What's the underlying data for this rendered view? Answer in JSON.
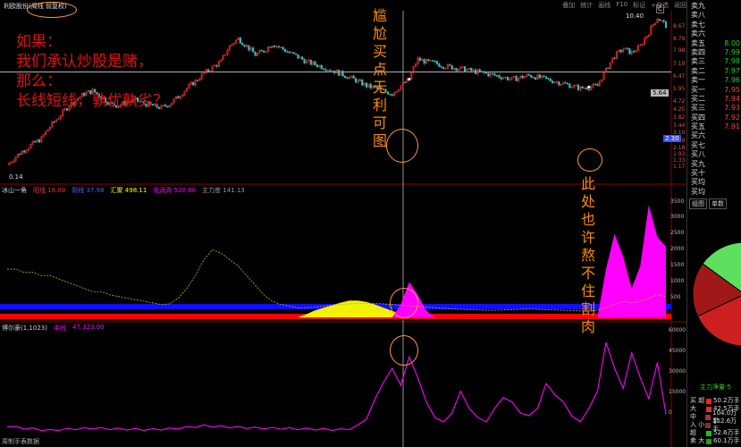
{
  "window": {
    "title": "利欧股份(周线 前复权)",
    "menu": [
      "叠加",
      "统计",
      "画线",
      "F10",
      "标记",
      "+自选",
      "返回"
    ]
  },
  "annotations": {
    "note_lines": [
      "如果：",
      "我们承认炒股是赌，",
      "那么：",
      "长线短线，孰优孰劣？"
    ],
    "label_buy": "尴尬买点无利可图",
    "label_cut": "此处也许熬不住割肉"
  },
  "colors": {
    "background": "#000000",
    "candle_up": "#ff3030",
    "candle_down": "#2ec4c4",
    "magenta": "#ff00ff",
    "blue_band": "#1010ff",
    "red_band": "#ff0000",
    "yellow": "#ffff00"
  },
  "price_panel": {
    "last_price_tag": "2.30",
    "high_label": "10.40",
    "low_label": "0.14",
    "marker_label": "5.64",
    "c_icon": "C",
    "axis_labels": [
      "8.67",
      "8.79",
      "7.98",
      "7.19",
      "6.47",
      "5.95",
      "4.72",
      "4.25",
      "3.82",
      "3.44",
      "3.10",
      "2.79",
      "2.18",
      "1.93",
      "1.33",
      "1.17"
    ]
  },
  "indicator1": {
    "name": "冰山一角",
    "items": [
      {
        "label": "阳线",
        "value": "16.00",
        "color": "#ff3030"
      },
      {
        "label": "阴线",
        "value": "37.98",
        "color": "#3a3aff"
      },
      {
        "label": "汇聚",
        "value": "498.11",
        "color": "#ffff00"
      },
      {
        "label": "花滴滴",
        "value": "520.80",
        "color": "#ff00ff"
      },
      {
        "label": "主力度",
        "value": "141.13",
        "color": "#999999"
      }
    ],
    "axis_labels": [
      "3500",
      "3000",
      "2500",
      "2000",
      "1500",
      "1000",
      "500"
    ]
  },
  "indicator2": {
    "name": "博尔豪(1,1023)",
    "item_label": "中线",
    "item_value": "47,323.00",
    "axis_labels": [
      "60000",
      "45000",
      "30000",
      "15000",
      "0"
    ],
    "footer": "周制手表数据"
  },
  "sidebar": {
    "order_book": [
      {
        "label": "卖九",
        "price": "",
        "side": "sell"
      },
      {
        "label": "卖八",
        "price": "",
        "side": "sell"
      },
      {
        "label": "卖七",
        "price": "",
        "side": "sell"
      },
      {
        "label": "卖六",
        "price": "",
        "side": "sell"
      },
      {
        "label": "卖五",
        "price": "8.00",
        "side": "sell"
      },
      {
        "label": "卖四",
        "price": "7.99",
        "side": "sell"
      },
      {
        "label": "卖三",
        "price": "7.98",
        "side": "sell"
      },
      {
        "label": "卖二",
        "price": "7.97",
        "side": "sell"
      },
      {
        "label": "卖一",
        "price": "7.96",
        "side": "sell"
      },
      {
        "label": "买一",
        "price": "7.95",
        "side": "buy"
      },
      {
        "label": "买二",
        "price": "7.94",
        "side": "buy"
      },
      {
        "label": "买三",
        "price": "7.93",
        "side": "buy"
      },
      {
        "label": "买四",
        "price": "7.92",
        "side": "buy"
      },
      {
        "label": "买五",
        "price": "7.91",
        "side": "buy"
      },
      {
        "label": "买六",
        "price": "",
        "side": "buy"
      },
      {
        "label": "买七",
        "price": "",
        "side": "buy"
      },
      {
        "label": "买八",
        "price": "",
        "side": "buy"
      },
      {
        "label": "买九",
        "price": "",
        "side": "buy"
      },
      {
        "label": "买十",
        "price": "",
        "side": "buy"
      },
      {
        "label": "买均",
        "price": "",
        "side": "buy"
      },
      {
        "label": "买均",
        "price": "",
        "side": "buy"
      }
    ],
    "tabs": [
      "组图",
      "单数"
    ],
    "net_flow_title": "主力净量-5",
    "flows": [
      {
        "label": "超",
        "side": "买",
        "value": "50.2万手",
        "color": "#ff2020"
      },
      {
        "label": "大",
        "side": "",
        "value": "42.5万手",
        "color": "#e03030"
      },
      {
        "label": "中",
        "side": "",
        "value": "104.0万手",
        "color": "#b03030"
      },
      {
        "label": "小",
        "side": "入",
        "value": "152.6万手",
        "color": "#803030"
      },
      {
        "label": "超",
        "side": "",
        "value": "52.6万手",
        "color": "#20c020"
      },
      {
        "label": "大",
        "side": "卖",
        "value": "60.1万手",
        "color": "#20a020"
      }
    ],
    "pie_colors": [
      "#3ccc3c",
      "#2a9a2a",
      "#1e7a1e",
      "#cc2020",
      "#a01818",
      "#5ee05e"
    ]
  },
  "chart_data": [
    {
      "type": "candlestick",
      "title": "利欧股份(周线 前复权)",
      "period": "weekly",
      "ylim": [
        0.14,
        10.4
      ],
      "y_log": true,
      "grid": false,
      "reference_line": 2.3,
      "close_series": [
        0.2,
        0.25,
        0.3,
        0.35,
        0.4,
        0.55,
        0.7,
        0.9,
        1.1,
        1.3,
        1.4,
        1.2,
        1.0,
        0.95,
        1.05,
        1.1,
        1.0,
        0.95,
        0.9,
        1.0,
        1.2,
        1.5,
        1.8,
        2.2,
        2.6,
        3.0,
        4.5,
        5.5,
        4.5,
        3.6,
        4.0,
        4.8,
        4.3,
        3.8,
        3.4,
        3.0,
        2.8,
        2.6,
        2.4,
        2.2,
        2.0,
        1.8,
        1.6,
        1.5,
        1.4,
        1.3,
        1.6,
        1.9,
        3.2,
        3.0,
        2.9,
        2.7,
        2.6,
        2.5,
        2.4,
        2.3,
        2.2,
        2.1,
        2.0,
        1.9,
        2.0,
        2.1,
        2.0,
        1.9,
        1.8,
        1.7,
        1.6,
        1.5,
        1.55,
        1.6,
        2.4,
        3.5,
        4.2,
        3.8,
        4.5,
        6.5,
        9.5,
        7.8
      ],
      "points": [
        {
          "label": "尴尬买点",
          "index": 47,
          "value": 1.9
        },
        {
          "label": "此处也许熬不住割肉",
          "index": 68,
          "value": 1.55
        }
      ]
    },
    {
      "type": "area",
      "title": "冰山一角",
      "ylim": [
        0,
        3700
      ],
      "series": [
        {
          "name": "汇聚",
          "values": [
            0,
            0,
            0,
            0,
            0,
            0,
            0,
            0,
            0,
            0,
            0,
            0,
            0,
            0,
            0,
            0,
            0,
            0,
            0,
            0,
            0,
            0,
            0,
            0,
            0,
            0,
            0,
            0,
            0,
            0,
            0,
            0,
            0,
            0,
            0,
            100,
            220,
            300,
            380,
            460,
            520,
            520,
            480,
            400,
            300,
            200,
            120,
            60,
            0,
            0,
            0,
            0,
            0,
            0,
            0,
            0,
            0,
            0,
            0,
            0,
            0,
            0,
            0,
            0,
            0,
            0,
            0,
            0,
            0,
            0,
            0,
            0,
            0,
            0,
            0,
            0,
            0,
            0
          ]
        },
        {
          "name": "花滴滴",
          "values": [
            0,
            0,
            0,
            0,
            0,
            0,
            0,
            0,
            0,
            0,
            0,
            0,
            0,
            0,
            0,
            0,
            0,
            0,
            0,
            0,
            0,
            0,
            0,
            0,
            0,
            0,
            0,
            0,
            0,
            0,
            0,
            0,
            0,
            0,
            0,
            0,
            0,
            0,
            0,
            0,
            0,
            0,
            0,
            0,
            0,
            0,
            400,
            1100,
            700,
            200,
            0,
            0,
            0,
            0,
            0,
            0,
            0,
            0,
            0,
            0,
            0,
            0,
            0,
            0,
            0,
            0,
            0,
            0,
            0,
            0,
            1500,
            2600,
            1900,
            900,
            1600,
            3500,
            2500,
            2200
          ]
        },
        {
          "name": "主力度",
          "values": [
            1500,
            1500,
            1400,
            1400,
            1300,
            1300,
            1200,
            1100,
            1000,
            900,
            800,
            800,
            700,
            650,
            600,
            550,
            500,
            450,
            400,
            420,
            600,
            900,
            1300,
            1800,
            2100,
            2000,
            1800,
            1600,
            1300,
            1000,
            700,
            500,
            400,
            350,
            300,
            300,
            320,
            350,
            380,
            400,
            420,
            430,
            440,
            430,
            420,
            400,
            380,
            360,
            340,
            320,
            300,
            280,
            260,
            250,
            240,
            230,
            220,
            220,
            230,
            240,
            250,
            260,
            250,
            240,
            230,
            220,
            210,
            200,
            200,
            220,
            300,
            400,
            500,
            450,
            500,
            600,
            700,
            650
          ]
        }
      ]
    },
    {
      "type": "line",
      "title": "博尔豪(1,1023)",
      "ylim": [
        -5000,
        65000
      ],
      "series": [
        {
          "name": "中线",
          "values": [
            3000,
            2000,
            1500,
            1000,
            500,
            0,
            500,
            800,
            1000,
            1200,
            1500,
            1200,
            1000,
            900,
            800,
            700,
            600,
            500,
            800,
            1000,
            1500,
            2000,
            2500,
            3000,
            2800,
            2500,
            2200,
            2000,
            1800,
            1600,
            1500,
            1400,
            1300,
            1200,
            1000,
            900,
            800,
            700,
            600,
            500,
            1000,
            3000,
            8000,
            20000,
            32000,
            40000,
            30000,
            47323,
            35000,
            18000,
            9000,
            5000,
            12000,
            25000,
            15000,
            8000,
            6000,
            14000,
            22000,
            18000,
            12000,
            9000,
            15000,
            30000,
            24000,
            18000,
            10000,
            5000,
            15000,
            25000,
            58000,
            40000,
            28000,
            50000,
            35000,
            20000,
            45000,
            10000
          ]
        }
      ]
    }
  ]
}
